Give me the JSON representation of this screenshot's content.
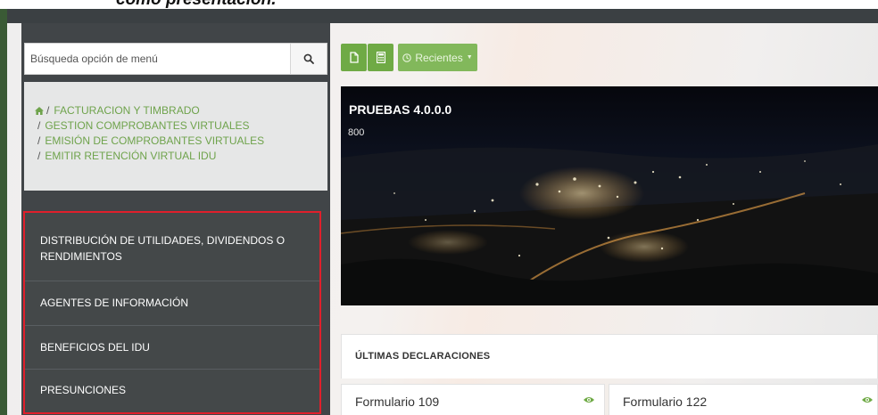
{
  "caption": {
    "text": "como presentación."
  },
  "search": {
    "placeholder": "Búsqueda opción de menú"
  },
  "breadcrumb": [
    "FACTURACION Y TIMBRADO",
    "GESTION COMPROBANTES VIRTUALES",
    "EMISIÓN DE COMPROBANTES VIRTUALES",
    "EMITIR RETENCIÓN VIRTUAL IDU"
  ],
  "breadcrumb_separator": "/",
  "menu": [
    {
      "label_line1": "DISTRIBUCIÓN DE UTILIDADES, DIVIDENDOS O",
      "label_line2": "RENDIMIENTOS"
    },
    {
      "label_line1": "AGENTES DE INFORMACIÓN"
    },
    {
      "label_line1": "BENEFICIOS DEL IDU"
    },
    {
      "label_line1": "PRESUNCIONES"
    }
  ],
  "toolbar": {
    "recent_label": "Recientes"
  },
  "banner": {
    "title": "PRUEBAS 4.0.0.0",
    "subtitle": "800"
  },
  "last_declarations": {
    "title": "ÚLTIMAS DECLARACIONES"
  },
  "cards": [
    {
      "title": "Formulario 109"
    },
    {
      "title": "Formulario 122"
    }
  ],
  "colors": {
    "accent_green": "#6faa45",
    "breadcrumb_green": "#6fa34c",
    "sidebar_dark": "#414548",
    "highlight_red": "#e01f2b"
  },
  "icons": {
    "search": "search-icon",
    "home": "home-icon",
    "new_document": "document-icon",
    "calculator": "calculator-icon",
    "recent": "clock-icon",
    "dropdown": "chevron-down-icon",
    "view": "eye-icon"
  }
}
